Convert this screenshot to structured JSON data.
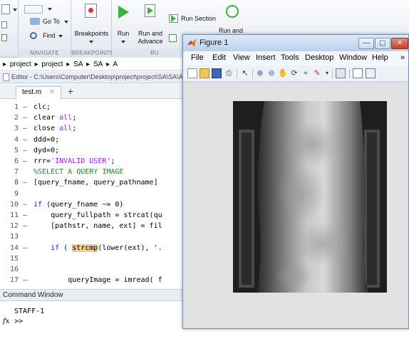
{
  "ribbon": {
    "goto_label": "Go To",
    "find_label": "Find",
    "breakpoints_label": "Breakpoints",
    "run_label": "Run",
    "run_advance_label": "Run and Advance",
    "run_section_label": "Run Section",
    "run_end_label": "Run and",
    "navigate_group": "NAVIGATE",
    "breakpoints_group": "BREAKPOINTS",
    "run_group": "RU"
  },
  "path": [
    "project",
    "project",
    "SA",
    "SA",
    "A"
  ],
  "editor": {
    "title": "Editor - C:\\Users\\Computer\\Desktop\\project\\project\\SA\\SA\\A\\test.m",
    "tab": "test.m"
  },
  "code": [
    {
      "n": "1",
      "dash": "–",
      "segs": [
        {
          "t": "clc;",
          "c": ""
        }
      ]
    },
    {
      "n": "2",
      "dash": "–",
      "segs": [
        {
          "t": "clear ",
          "c": ""
        },
        {
          "t": "all",
          "c": "st"
        },
        {
          "t": ";",
          "c": ""
        }
      ]
    },
    {
      "n": "3",
      "dash": "–",
      "segs": [
        {
          "t": "close ",
          "c": ""
        },
        {
          "t": "all",
          "c": "st"
        },
        {
          "t": ";",
          "c": ""
        }
      ]
    },
    {
      "n": "4",
      "dash": "–",
      "segs": [
        {
          "t": "ddd=0;",
          "c": ""
        }
      ]
    },
    {
      "n": "5",
      "dash": "–",
      "segs": [
        {
          "t": "dyd=0;",
          "c": ""
        }
      ]
    },
    {
      "n": "6",
      "dash": "–",
      "segs": [
        {
          "t": "rrr=",
          "c": ""
        },
        {
          "t": "'INVALID USER'",
          "c": "st"
        },
        {
          "t": ";",
          "c": ""
        }
      ]
    },
    {
      "n": "7",
      "dash": "",
      "segs": [
        {
          "t": "%SELECT A QUERY IMAGE",
          "c": "cm"
        }
      ]
    },
    {
      "n": "8",
      "dash": "–",
      "segs": [
        {
          "t": "[query_fname, query_pathname]",
          "c": ""
        }
      ]
    },
    {
      "n": "9",
      "dash": "",
      "segs": []
    },
    {
      "n": "10",
      "dash": "–",
      "segs": [
        {
          "t": "if",
          "c": "kw"
        },
        {
          "t": " (query_fname ~= 0)",
          "c": ""
        }
      ]
    },
    {
      "n": "11",
      "dash": "–",
      "segs": [
        {
          "t": "    query_fullpath = strcat(qu",
          "c": ""
        }
      ]
    },
    {
      "n": "12",
      "dash": "–",
      "segs": [
        {
          "t": "    [pathstr, name, ext] = fil",
          "c": ""
        }
      ]
    },
    {
      "n": "13",
      "dash": "",
      "segs": []
    },
    {
      "n": "14",
      "dash": "–",
      "segs": [
        {
          "t": "    ",
          "c": ""
        },
        {
          "t": "if",
          "c": "kw"
        },
        {
          "t": " ( ",
          "c": ""
        },
        {
          "t": "strcmp",
          "c": "hl"
        },
        {
          "t": "(lower(ext), '.",
          "c": ""
        }
      ]
    },
    {
      "n": "15",
      "dash": "",
      "segs": []
    },
    {
      "n": "16",
      "dash": "",
      "segs": []
    },
    {
      "n": "17",
      "dash": "–",
      "segs": [
        {
          "t": "        queryImage = imread( f",
          "c": ""
        }
      ]
    }
  ],
  "command_window": {
    "title": "Command Window",
    "output": "STAFF-1",
    "fx": "fx",
    "prompt": ">>"
  },
  "figure": {
    "title": "Figure 1",
    "menu": [
      "File",
      "Edit",
      "View",
      "Insert",
      "Tools",
      "Desktop",
      "Window",
      "Help"
    ],
    "overflow_glyph": "»"
  },
  "colors": {
    "run_green": "#3cb043",
    "keyword": "#1010ff",
    "string": "#a020f0",
    "comment": "#228b22",
    "highlight": "#f5c98f"
  }
}
